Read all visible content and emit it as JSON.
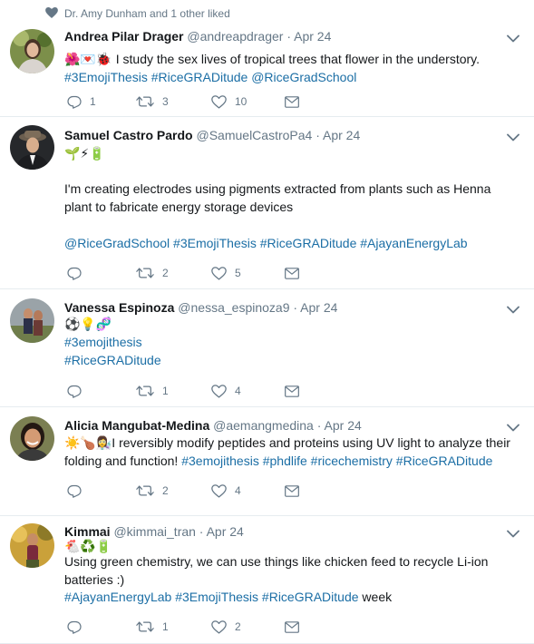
{
  "liked_bar": {
    "text": "Dr. Amy Dunham and 1 other liked"
  },
  "tweets": [
    {
      "name": "Andrea Pilar Drager",
      "handle": "@andreapdrager",
      "date": "Apr 24",
      "lines": [
        {
          "segments": [
            {
              "text": "🌺💌🐞 ",
              "type": "emoji"
            },
            {
              "text": "I study the sex lives of tropical trees that flower in the understory.",
              "type": "text"
            }
          ]
        },
        {
          "segments": [
            {
              "text": "#3EmojiThesis",
              "type": "tag"
            },
            {
              "text": " ",
              "type": "text"
            },
            {
              "text": "#RiceGRADitude",
              "type": "tag"
            },
            {
              "text": " ",
              "type": "text"
            },
            {
              "text": "@RiceGradSchool",
              "type": "tag"
            }
          ]
        }
      ],
      "reply_count": "1",
      "retweet_count": "3",
      "like_count": "10"
    },
    {
      "name": "Samuel Castro Pardo",
      "handle": "@SamuelCastroPa4",
      "date": "Apr 24",
      "lines": [
        {
          "segments": [
            {
              "text": "🌱⚡🔋",
              "type": "emoji"
            }
          ]
        },
        {
          "segments": [
            {
              "text": "I'm creating electrodes using pigments extracted from plants such as Henna",
              "type": "text"
            }
          ]
        },
        {
          "segments": [
            {
              "text": "plant to fabricate energy storage devices",
              "type": "text"
            }
          ]
        },
        {
          "segments": [
            {
              "text": "@RiceGradSchool",
              "type": "tag"
            },
            {
              "text": " ",
              "type": "text"
            },
            {
              "text": "#3EmojiThesis",
              "type": "tag"
            },
            {
              "text": " ",
              "type": "text"
            },
            {
              "text": "#RiceGRADitude",
              "type": "tag"
            },
            {
              "text": " ",
              "type": "text"
            },
            {
              "text": "#AjayanEnergyLab",
              "type": "tag"
            }
          ]
        }
      ],
      "reply_count": "",
      "retweet_count": "2",
      "like_count": "5"
    },
    {
      "name": "Vanessa Espinoza",
      "handle": "@nessa_espinoza9",
      "date": "Apr 24",
      "lines": [
        {
          "segments": [
            {
              "text": "⚽💡🧬",
              "type": "emoji"
            }
          ]
        },
        {
          "segments": [
            {
              "text": "#3emojithesis",
              "type": "tag"
            }
          ]
        },
        {
          "segments": [
            {
              "text": "#RiceGRADitude",
              "type": "tag"
            }
          ]
        }
      ],
      "reply_count": "",
      "retweet_count": "1",
      "like_count": "4"
    },
    {
      "name": "Alicia Mangubat-Medina",
      "handle": "@aemangmedina",
      "date": "Apr 24",
      "lines": [
        {
          "segments": [
            {
              "text": "☀️🍗👩‍🔬",
              "type": "emoji"
            },
            {
              "text": "I reversibly modify peptides and proteins using UV light to analyze their",
              "type": "text"
            }
          ]
        },
        {
          "segments": [
            {
              "text": "folding and function! ",
              "type": "text"
            },
            {
              "text": "#3emojithesis",
              "type": "tag"
            },
            {
              "text": " ",
              "type": "text"
            },
            {
              "text": "#phdlife",
              "type": "tag"
            },
            {
              "text": " ",
              "type": "text"
            },
            {
              "text": "#ricechemistry",
              "type": "tag"
            },
            {
              "text": " ",
              "type": "text"
            },
            {
              "text": "#RiceGRADitude",
              "type": "tag"
            }
          ]
        }
      ],
      "reply_count": "",
      "retweet_count": "2",
      "like_count": "4"
    },
    {
      "name": "Kimmai",
      "handle": "@kimmai_tran",
      "date": "Apr 24",
      "lines": [
        {
          "segments": [
            {
              "text": "🐔♻️🔋",
              "type": "emoji"
            }
          ]
        },
        {
          "segments": [
            {
              "text": "Using green chemistry, we can use things like chicken feed to recycle Li-ion",
              "type": "text"
            }
          ]
        },
        {
          "segments": [
            {
              "text": "batteries :)",
              "type": "text"
            }
          ]
        },
        {
          "segments": [
            {
              "text": "#AjayanEnergyLab",
              "type": "tag"
            },
            {
              "text": " ",
              "type": "text"
            },
            {
              "text": "#3EmojiThesis",
              "type": "tag"
            },
            {
              "text": " ",
              "type": "text"
            },
            {
              "text": "#RiceGRADitude",
              "type": "tag"
            },
            {
              "text": " week",
              "type": "text"
            }
          ]
        }
      ],
      "reply_count": "",
      "retweet_count": "1",
      "like_count": "2"
    }
  ],
  "colors": {
    "link": "#1b6ea5",
    "muted": "#657786",
    "divider": "#e6ecf0",
    "text": "#14171a"
  },
  "icons": {
    "reply": "reply-icon",
    "retweet": "retweet-icon",
    "like": "heart-icon",
    "message": "envelope-icon",
    "menu": "chevron-down-icon"
  }
}
